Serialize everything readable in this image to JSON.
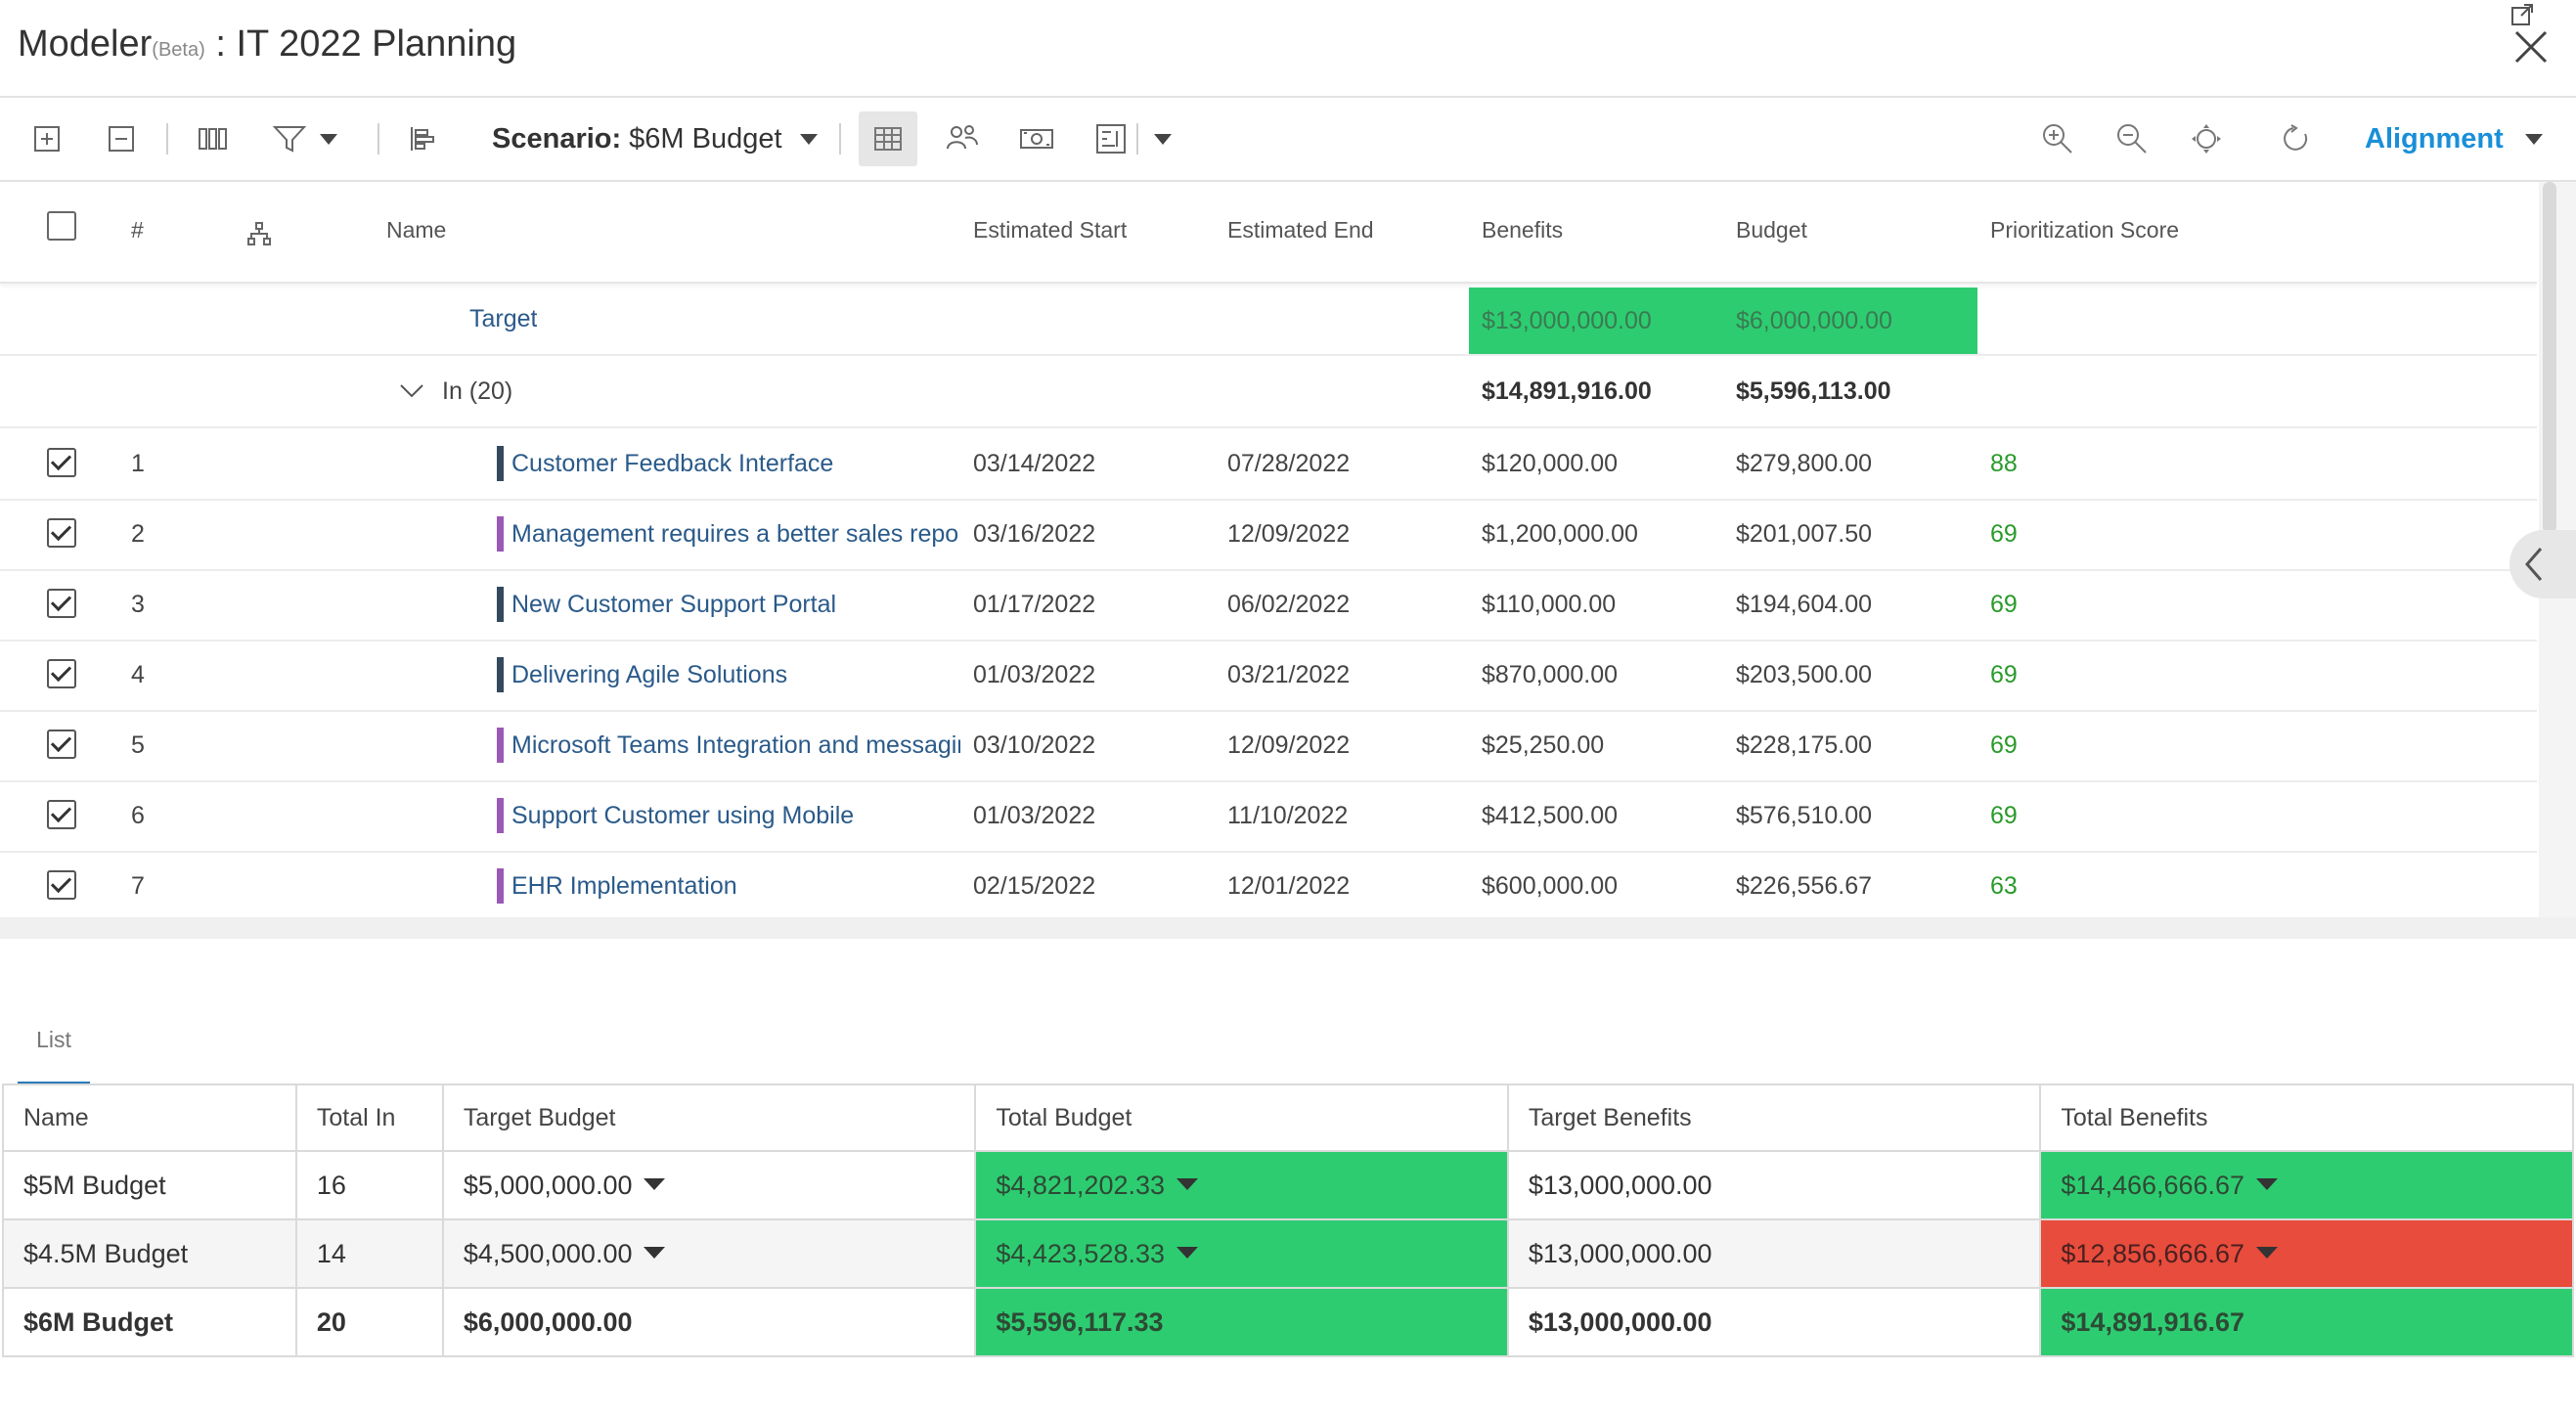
{
  "header": {
    "app_name": "Modeler",
    "beta_label": "(Beta)",
    "title_sep": " : ",
    "plan_title": "IT 2022 Planning"
  },
  "toolbar": {
    "scenario_label": "Scenario:",
    "scenario_value": "$6M Budget",
    "alignment_label": "Alignment"
  },
  "grid": {
    "columns": {
      "number": "#",
      "name": "Name",
      "estimated_start": "Estimated Start",
      "estimated_end": "Estimated End",
      "benefits": "Benefits",
      "budget": "Budget",
      "prioritization_score": "Prioritization Score"
    },
    "target": {
      "label": "Target",
      "benefits": "$13,000,000.00",
      "budget": "$6,000,000.00"
    },
    "group": {
      "label": "In (20)",
      "benefits": "$14,891,916.00",
      "budget": "$5,596,113.00"
    },
    "rows": [
      {
        "num": "1",
        "name": "Customer Feedback Interface",
        "start": "03/14/2022",
        "end": "07/28/2022",
        "benefits": "$120,000.00",
        "budget": "$279,800.00",
        "score": "88",
        "bar_color": "#34495e"
      },
      {
        "num": "2",
        "name": "Management requires a better sales report",
        "start": "03/16/2022",
        "end": "12/09/2022",
        "benefits": "$1,200,000.00",
        "budget": "$201,007.50",
        "score": "69",
        "bar_color": "#9b59b6"
      },
      {
        "num": "3",
        "name": "New Customer Support Portal",
        "start": "01/17/2022",
        "end": "06/02/2022",
        "benefits": "$110,000.00",
        "budget": "$194,604.00",
        "score": "69",
        "bar_color": "#34495e"
      },
      {
        "num": "4",
        "name": "Delivering Agile Solutions",
        "start": "01/03/2022",
        "end": "03/21/2022",
        "benefits": "$870,000.00",
        "budget": "$203,500.00",
        "score": "69",
        "bar_color": "#34495e"
      },
      {
        "num": "5",
        "name": "Microsoft Teams Integration and messaging",
        "start": "03/10/2022",
        "end": "12/09/2022",
        "benefits": "$25,250.00",
        "budget": "$228,175.00",
        "score": "69",
        "bar_color": "#9b59b6"
      },
      {
        "num": "6",
        "name": "Support Customer using Mobile",
        "start": "01/03/2022",
        "end": "11/10/2022",
        "benefits": "$412,500.00",
        "budget": "$576,510.00",
        "score": "69",
        "bar_color": "#9b59b6"
      },
      {
        "num": "7",
        "name": "EHR Implementation",
        "start": "02/15/2022",
        "end": "12/01/2022",
        "benefits": "$600,000.00",
        "budget": "$226,556.67",
        "score": "63",
        "bar_color": "#9b59b6"
      }
    ]
  },
  "list_tab": {
    "label": "List"
  },
  "summary": {
    "columns": [
      "Name",
      "Total In",
      "Target Budget",
      "Total Budget",
      "Target Benefits",
      "Total Benefits"
    ],
    "rows": [
      {
        "name": "$5M Budget",
        "total_in": "16",
        "target_budget": "$5,000,000.00",
        "total_budget": "$4,821,202.33",
        "target_benefits": "$13,000,000.00",
        "total_benefits": "$14,466,666.67",
        "total_budget_status": "green",
        "total_benefits_status": "green"
      },
      {
        "name": "$4.5M Budget",
        "total_in": "14",
        "target_budget": "$4,500,000.00",
        "total_budget": "$4,423,528.33",
        "target_benefits": "$13,000,000.00",
        "total_benefits": "$12,856,666.67",
        "total_budget_status": "green",
        "total_benefits_status": "red"
      },
      {
        "name": "$6M Budget",
        "total_in": "20",
        "target_budget": "$6,000,000.00",
        "total_budget": "$5,596,117.33",
        "target_benefits": "$13,000,000.00",
        "total_benefits": "$14,891,916.67",
        "total_budget_status": "green",
        "total_benefits_status": "green"
      }
    ]
  },
  "colors": {
    "accent": "#1a8fd8",
    "status_green": "#2ecc71",
    "status_red": "#e74c3c",
    "score_green": "#2a9a2a"
  }
}
